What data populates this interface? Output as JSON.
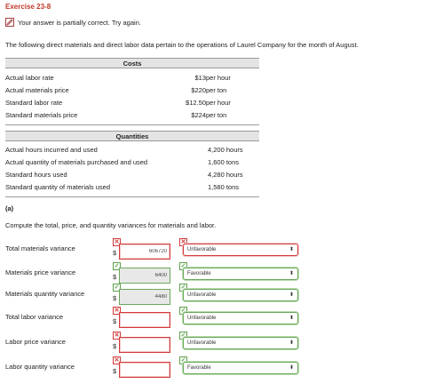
{
  "header": {
    "exercise_title": "Exercise 23-8",
    "partial_status": "Your answer is partially correct.  Try again."
  },
  "intro": "The following direct materials and direct labor data pertain to the operations of Laurel Company for the month of August.",
  "costs": {
    "heading": "Costs",
    "rows": [
      {
        "label": "Actual labor rate",
        "value": "$13",
        "unit": "per hour"
      },
      {
        "label": "Actual materials price",
        "value": "$220",
        "unit": "per ton"
      },
      {
        "label": "Standard labor rate",
        "value": "$12.50",
        "unit": "per hour"
      },
      {
        "label": "Standard materials price",
        "value": "$224",
        "unit": "per ton"
      }
    ]
  },
  "quantities": {
    "heading": "Quantities",
    "rows": [
      {
        "label": "Actual hours incurred and used",
        "value": "4,200 hours"
      },
      {
        "label": "Actual quantity of materials purchased and used",
        "value": "1,600 tons"
      },
      {
        "label": "Standard hours used",
        "value": "4,280 hours"
      },
      {
        "label": "Standard quantity of materials used",
        "value": "1,580 tons"
      }
    ]
  },
  "part_a": {
    "label": "(a)",
    "instruction": "Compute the total, price, and quantity variances for materials and labor."
  },
  "variances": [
    {
      "label": "Total materials variance",
      "currency": "$",
      "amount": "606720",
      "amount_status": "wrong",
      "select_value": "Unfavorable",
      "select_status": "wrong"
    },
    {
      "label": "Materials price variance",
      "currency": "$",
      "amount": "6400",
      "amount_status": "right",
      "select_value": "Favorable",
      "select_status": "right"
    },
    {
      "label": "Materials quantity variance",
      "currency": "$",
      "amount": "4480",
      "amount_status": "right",
      "select_value": "Unfavorable",
      "select_status": "right"
    },
    {
      "label": "Total labor variance",
      "currency": "$",
      "amount": "",
      "amount_status": "wrong",
      "select_value": "Unfavorable",
      "select_status": "right"
    },
    {
      "label": "Labor price variance",
      "currency": "$",
      "amount": "",
      "amount_status": "wrong",
      "select_value": "Unfavorable",
      "select_status": "right"
    },
    {
      "label": "Labor quantity variance",
      "currency": "$",
      "amount": "",
      "amount_status": "wrong",
      "select_value": "Favorable",
      "select_status": "right"
    }
  ],
  "colors": {
    "error": "#d23b3b",
    "correct": "#5da24a",
    "title": "#c0392b"
  }
}
